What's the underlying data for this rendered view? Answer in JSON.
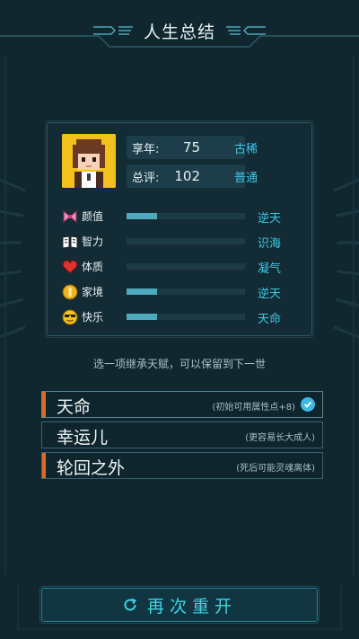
{
  "header": {
    "title": "人生总结"
  },
  "summary": {
    "age_label": "享年:",
    "age_value": "75",
    "age_rank": "古稀",
    "score_label": "总评:",
    "score_value": "102",
    "score_rank": "普通"
  },
  "attributes": [
    {
      "label": "颜值",
      "rank": "逆天",
      "icon": "ribbon-icon",
      "fill": 0.26
    },
    {
      "label": "智力",
      "rank": "识海",
      "icon": "book-icon",
      "fill": 0.0
    },
    {
      "label": "体质",
      "rank": "凝气",
      "icon": "heart-icon",
      "fill": 0.0
    },
    {
      "label": "家境",
      "rank": "逆天",
      "icon": "coin-icon",
      "fill": 0.26
    },
    {
      "label": "快乐",
      "rank": "天命",
      "icon": "sunglasses-icon",
      "fill": 0.26
    }
  ],
  "hint": "选一项继承天赋，可以保留到下一世",
  "talents": [
    {
      "name": "天命",
      "desc": "(初始可用属性点+8)",
      "selected": true,
      "accent": true
    },
    {
      "name": "幸运儿",
      "desc": "(更容易长大成人)",
      "selected": false,
      "accent": false
    },
    {
      "name": "轮回之外",
      "desc": "(死后可能灵魂离体)",
      "selected": false,
      "accent": true
    }
  ],
  "restart": {
    "label": "再次重开"
  },
  "colors": {
    "accent_cyan": "#3fc7e7",
    "accent_orange": "#e06a1e",
    "avatar_bg": "#f2c11c"
  }
}
